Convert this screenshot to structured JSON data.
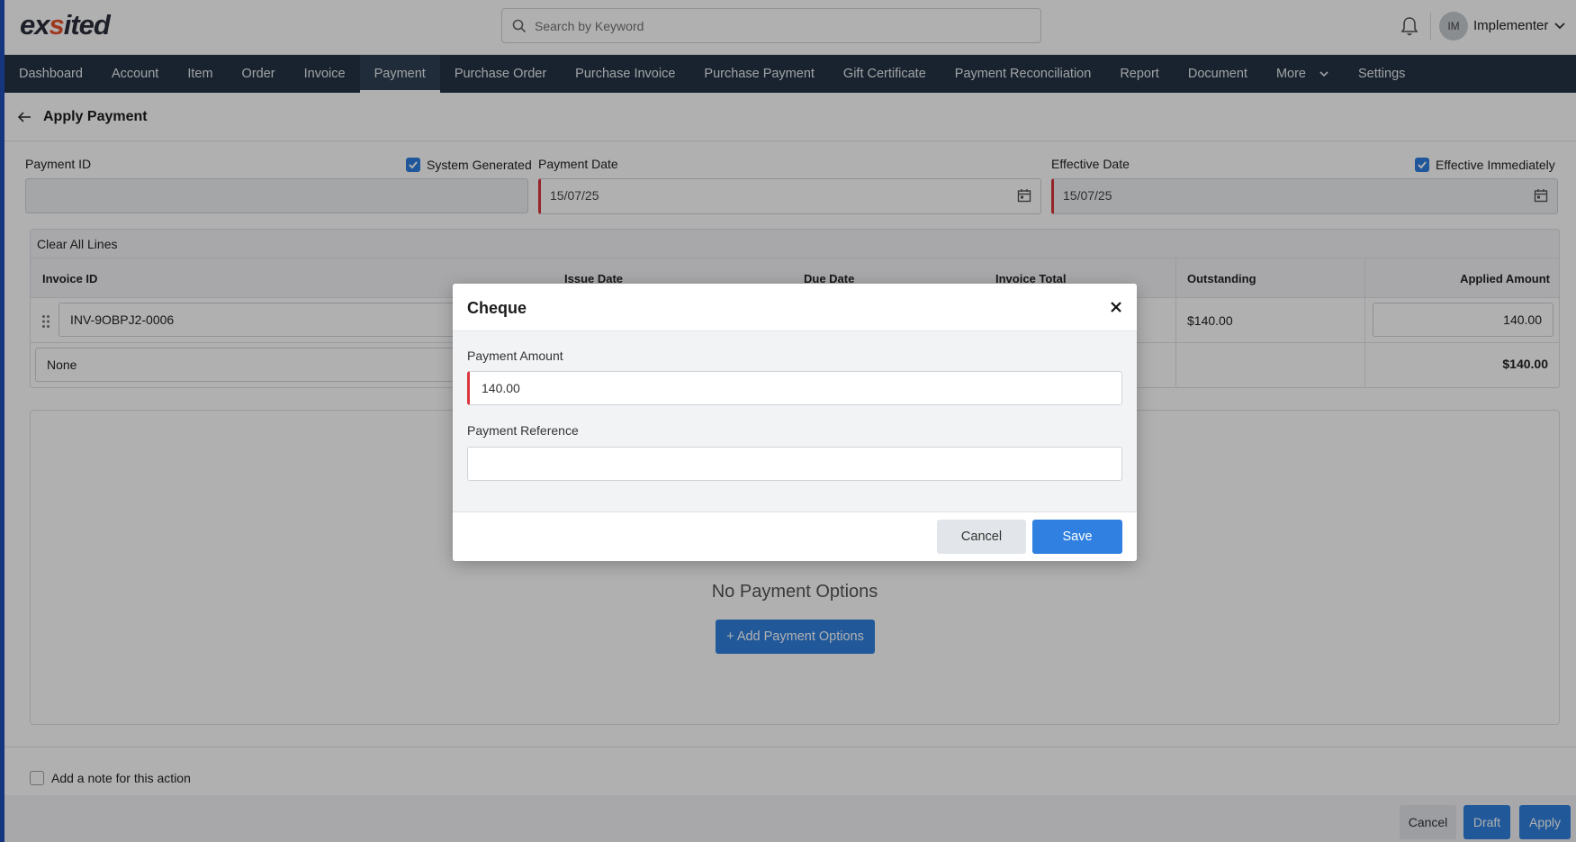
{
  "header": {
    "logo_prefix": "ex",
    "logo_accent": "s",
    "logo_suffix": "ited",
    "search_placeholder": "Search by Keyword",
    "avatar_initials": "IM",
    "user_name": "Implementer"
  },
  "nav": {
    "items": [
      "Dashboard",
      "Account",
      "Item",
      "Order",
      "Invoice",
      "Payment",
      "Purchase Order",
      "Purchase Invoice",
      "Purchase Payment",
      "Gift Certificate",
      "Payment Reconciliation",
      "Report",
      "Document",
      "More",
      "Settings"
    ],
    "active": "Payment"
  },
  "page": {
    "title": "Apply Payment",
    "payment_id_label": "Payment ID",
    "system_generated_label": "System Generated",
    "payment_date_label": "Payment Date",
    "payment_date_value": "15/07/25",
    "effective_date_label": "Effective Date",
    "effective_immediately_label": "Effective Immediately",
    "effective_date_value": "15/07/25"
  },
  "grid": {
    "clear_all_label": "Clear All Lines",
    "columns": [
      "Invoice ID",
      "Issue Date",
      "Due Date",
      "Invoice Total",
      "Outstanding",
      "Applied Amount"
    ],
    "row": {
      "invoice_id": "INV-9OBPJ2-0006",
      "outstanding": "$140.00",
      "applied_amount": "140.00"
    },
    "footer_row": {
      "selector": "None",
      "total": "$140.00"
    }
  },
  "payment_options": {
    "empty_text": "No Payment Options",
    "add_label": "Add Payment Options"
  },
  "note": {
    "label": "Add a note for this action"
  },
  "footer": {
    "cancel": "Cancel",
    "draft": "Draft",
    "apply": "Apply"
  },
  "modal": {
    "title": "Cheque",
    "amount_label": "Payment Amount",
    "amount_value": "140.00",
    "reference_label": "Payment Reference",
    "reference_value": "",
    "cancel": "Cancel",
    "save": "Save"
  },
  "colors": {
    "nav_bg": "#253444",
    "primary": "#2f80e0",
    "required": "#d9363e",
    "logo_accent": "#e6512d"
  }
}
